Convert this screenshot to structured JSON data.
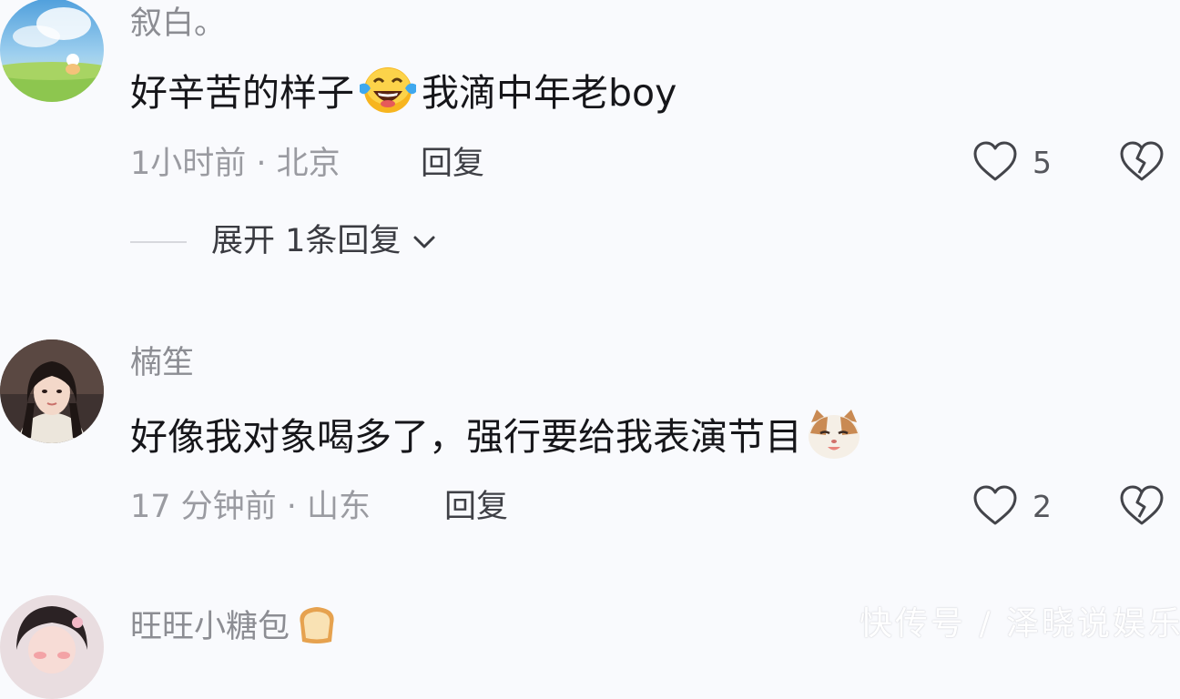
{
  "comments": [
    {
      "username": "叙白。",
      "text_before": "好辛苦的样子",
      "emoji": "laughing-crying-emoji",
      "text_after": "我滴中年老boy",
      "time": "1小时前 · 北京",
      "reply_label": "回复",
      "likes": "5",
      "expand_label": "展开 1条回复"
    },
    {
      "username": "楠笙",
      "text_before": "好像我对象喝多了，强行要给我表演节目",
      "emoji": "cat-face-emoji",
      "text_after": "",
      "time": "17 分钟前 · 山东",
      "reply_label": "回复",
      "likes": "2"
    },
    {
      "username": "旺旺小糖包",
      "emoji": "bread-emoji"
    }
  ],
  "watermark": "快传号 / 泽晓说娱乐",
  "colors": {
    "background": "#f9fafd",
    "username": "#8c8d93",
    "meta": "#9a9ba1",
    "text": "#16161a"
  }
}
